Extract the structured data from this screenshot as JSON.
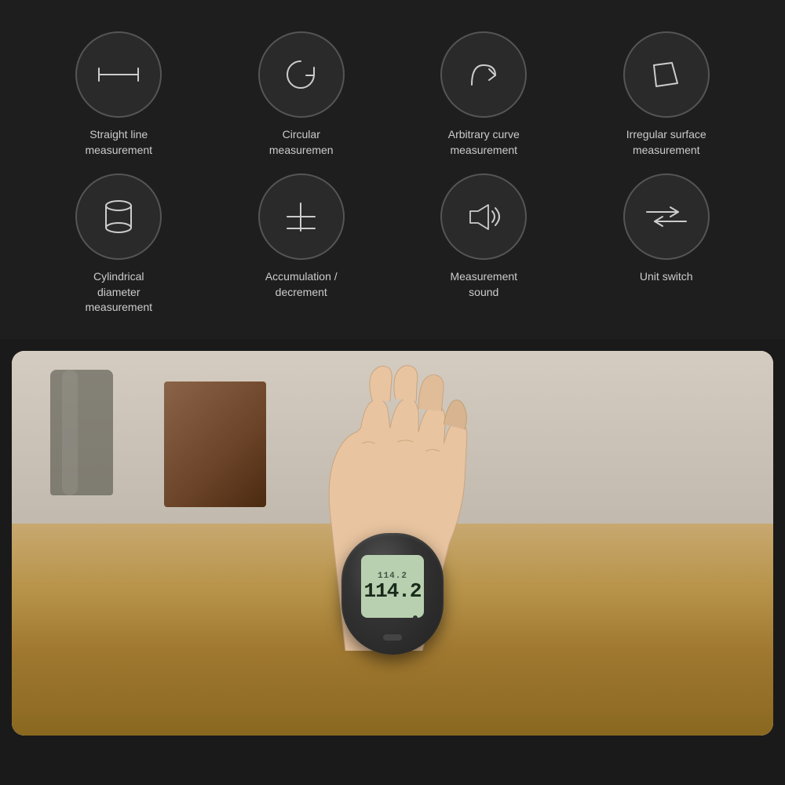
{
  "features": [
    {
      "id": "straight-line",
      "label": "Straight line\nmeasurement",
      "icon": "straight-line-icon"
    },
    {
      "id": "circular",
      "label": "Circular\nmeasuremen",
      "icon": "circular-icon"
    },
    {
      "id": "arbitrary-curve",
      "label": "Arbitrary curve\nmeasurement",
      "icon": "arbitrary-curve-icon"
    },
    {
      "id": "irregular-surface",
      "label": "Irregular surface\nmeasurement",
      "icon": "irregular-surface-icon"
    },
    {
      "id": "cylindrical",
      "label": "Cylindrical\ndiameter\nmeasurement",
      "icon": "cylindrical-icon"
    },
    {
      "id": "accumulation",
      "label": "Accumulation /\ndecrement",
      "icon": "accumulation-icon"
    },
    {
      "id": "measurement-sound",
      "label": "Measurement\nsound",
      "icon": "sound-icon"
    },
    {
      "id": "unit-switch",
      "label": "Unit switch",
      "icon": "unit-switch-icon"
    }
  ],
  "device": {
    "display_top": "114.2",
    "display_main": "114.2"
  },
  "colors": {
    "background": "#1a1a1a",
    "circle_border": "#555555",
    "circle_bg": "#2a2a2a",
    "icon_stroke": "#cccccc",
    "text": "#cccccc"
  }
}
